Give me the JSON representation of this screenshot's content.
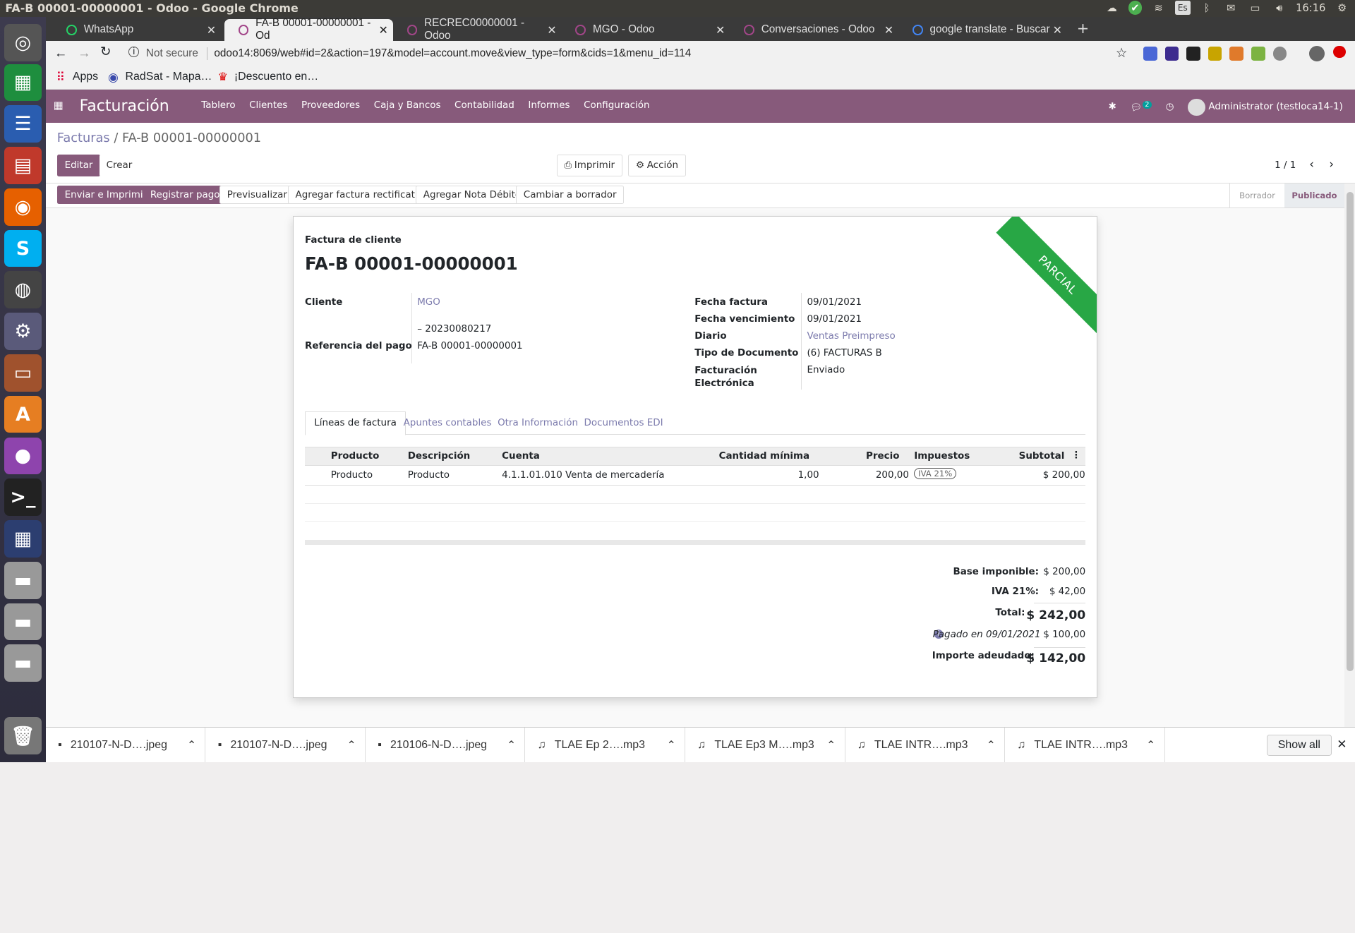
{
  "window": {
    "title": "FA-B 00001-00000001 - Odoo - Google Chrome",
    "clock": "16:16",
    "lang": "Es"
  },
  "tabs": [
    {
      "label": "WhatsApp"
    },
    {
      "label": "FA-B 00001-00000001 - Od"
    },
    {
      "label": "RECREC00000001 - Odoo"
    },
    {
      "label": "MGO - Odoo"
    },
    {
      "label": "Conversaciones - Odoo"
    },
    {
      "label": "google translate - Buscar"
    }
  ],
  "omnibar": {
    "security": "Not secure",
    "url": "odoo14:8069/web#id=2&action=197&model=account.move&view_type=form&cids=1&menu_id=114"
  },
  "bookmarks": [
    "Apps",
    "RadSat - Mapa…",
    "¡Descuento en…"
  ],
  "odoo": {
    "app": "Facturación",
    "menu": [
      "Tablero",
      "Clientes",
      "Proveedores",
      "Caja y Bancos",
      "Contabilidad",
      "Informes",
      "Configuración"
    ],
    "chat_count": "2",
    "user": "Administrator (testloca14-1)"
  },
  "breadcrumb": {
    "parent": "Facturas",
    "sep": "/",
    "current": "FA-B 00001-00000001"
  },
  "cp": {
    "edit": "Editar",
    "create": "Crear",
    "print": "Imprimir",
    "action": "Acción",
    "pager": "1 / 1"
  },
  "header_buttons": [
    "Enviar e Imprimir",
    "Registrar pago",
    "Previsualizar",
    "Agregar factura rectificativa",
    "Agregar Nota Débito",
    "Cambiar a borrador"
  ],
  "states": [
    "Borrador",
    "Publicado"
  ],
  "invoice": {
    "type": "Factura de cliente",
    "number": "FA-B 00001-00000001",
    "ribbon": "PARCIAL",
    "left": {
      "cliente_l": "Cliente",
      "cliente_v": "MGO",
      "cuit_v": "– 20230080217",
      "ref_l": "Referencia del pago",
      "ref_v": "FA-B 00001-00000001"
    },
    "right": [
      {
        "l": "Fecha factura",
        "v": "09/01/2021"
      },
      {
        "l": "Fecha vencimiento",
        "v": "09/01/2021"
      },
      {
        "l": "Diario",
        "v": "Ventas Preimpreso"
      },
      {
        "l": "Tipo de Documento",
        "v": "(6) FACTURAS B"
      },
      {
        "l": "Facturación Electrónica",
        "v": "Enviado"
      }
    ],
    "tabs": [
      "Líneas de factura",
      "Apuntes contables",
      "Otra Información",
      "Documentos EDI"
    ],
    "cols": [
      "Producto",
      "Descripción",
      "Cuenta",
      "Cantidad mínima",
      "Precio",
      "Impuestos",
      "Subtotal"
    ],
    "line": {
      "producto": "Producto",
      "descripcion": "Producto",
      "cuenta": "4.1.1.01.010 Venta de mercadería",
      "cantidad": "1,00",
      "precio": "200,00",
      "impuesto": "IVA 21%",
      "subtotal": "$ 200,00"
    },
    "totals": {
      "base_l": "Base imponible:",
      "base_v": "$ 200,00",
      "iva_l": "IVA 21%:",
      "iva_v": "$ 42,00",
      "total_l": "Total:",
      "total_v": "$ 242,00",
      "paid_l": "Pagado en 09/01/2021",
      "paid_v": "$ 100,00",
      "due_l": "Importe adeudado:",
      "due_v": "$ 142,00"
    }
  },
  "downloads": [
    "210107-N-D….jpeg",
    "210107-N-D….jpeg",
    "210106-N-D….jpeg",
    "TLAE Ep 2….mp3",
    "TLAE Ep3 M….mp3",
    "TLAE INTR….mp3",
    "TLAE INTR….mp3"
  ],
  "show_all": "Show all"
}
